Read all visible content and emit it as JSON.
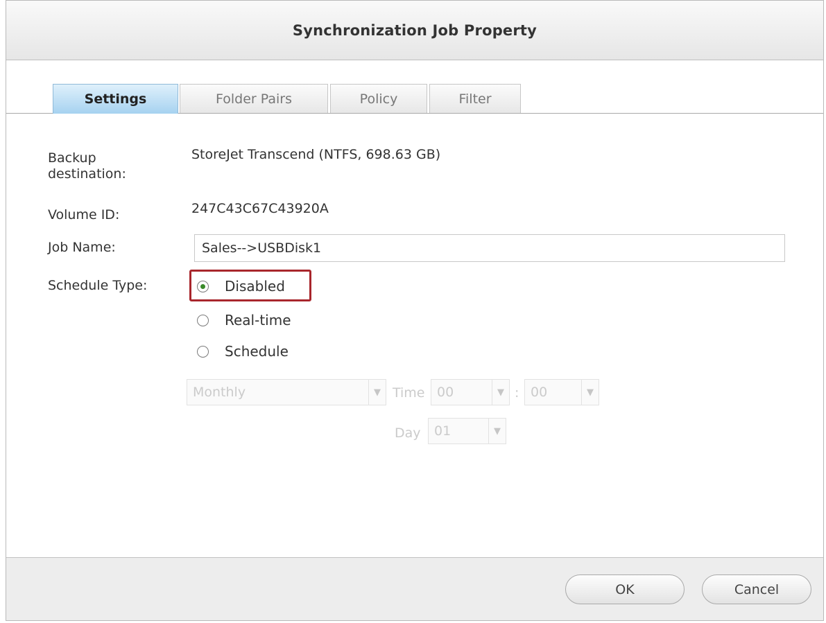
{
  "dialog": {
    "title": "Synchronization Job Property"
  },
  "tabs": [
    {
      "label": "Settings",
      "active": true
    },
    {
      "label": "Folder Pairs",
      "active": false
    },
    {
      "label": "Policy",
      "active": false
    },
    {
      "label": "Filter",
      "active": false
    }
  ],
  "settings": {
    "backup_destination_label_line1": "Backup",
    "backup_destination_label_line2": "destination:",
    "backup_destination_value": "StoreJet Transcend (NTFS, 698.63 GB)",
    "volume_id_label": "Volume ID:",
    "volume_id_value": "247C43C67C43920A",
    "job_name_label": "Job Name:",
    "job_name_value": "Sales-->USBDisk1",
    "schedule_type_label": "Schedule Type:",
    "schedule_options": [
      {
        "label": "Disabled",
        "selected": true
      },
      {
        "label": "Real-time",
        "selected": false
      },
      {
        "label": "Schedule",
        "selected": false
      }
    ],
    "schedule": {
      "frequency_value": "Monthly",
      "time_label": "Time",
      "hour_value": "00",
      "time_separator": ":",
      "minute_value": "00",
      "day_label": "Day",
      "day_value": "01"
    }
  },
  "footer": {
    "ok_label": "OK",
    "cancel_label": "Cancel"
  },
  "colors": {
    "active_tab": "#a6d2f0",
    "highlight_box": "#a8262c",
    "radio_selected": "#3a8a2a"
  }
}
